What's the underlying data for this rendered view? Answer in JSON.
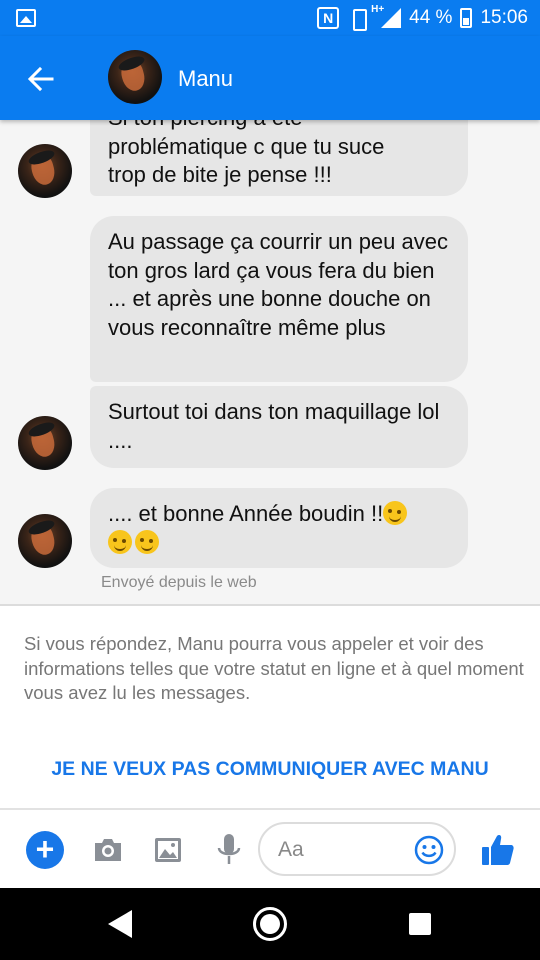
{
  "status_bar": {
    "battery": "44 %",
    "time": "15:06",
    "network": "H+",
    "nfc": "N"
  },
  "header": {
    "contact_name": "Manu"
  },
  "messages": [
    {
      "line1": "Si ton piercing a été",
      "line2": "problématique c que tu suce",
      "line3": "trop de bite je pense !!!"
    },
    {
      "text": "Au passage ça courrir un peu avec ton gros lard ça vous fera du bien ... et après une bonne douche on vous reconnaître même plus"
    },
    {
      "text": "Surtout toi dans ton maquillage lol ...."
    },
    {
      "text": ".... et bonne Année boudin !!"
    }
  ],
  "sent_from": "Envoyé depuis le web",
  "notice": "Si vous répondez, Manu pourra vous appeler et voir des informations telles que votre statut en ligne et à quel moment vous avez lu les messages.",
  "block_link": "JE NE VEUX PAS COMMUNIQUER AVEC MANU",
  "composer": {
    "placeholder": "Aa",
    "plus_label": "+"
  },
  "colors": {
    "brand": "#0a7cf0",
    "link": "#1877e8",
    "bubble": "#e6e6e6"
  },
  "icons": [
    "gallery-icon",
    "nfc-icon",
    "vibrate-icon",
    "signal-icon",
    "battery-icon",
    "back-arrow-icon",
    "camera-icon",
    "image-icon",
    "mic-icon",
    "smiley-icon",
    "like-icon",
    "nav-back-icon",
    "nav-home-icon",
    "nav-recent-icon"
  ]
}
